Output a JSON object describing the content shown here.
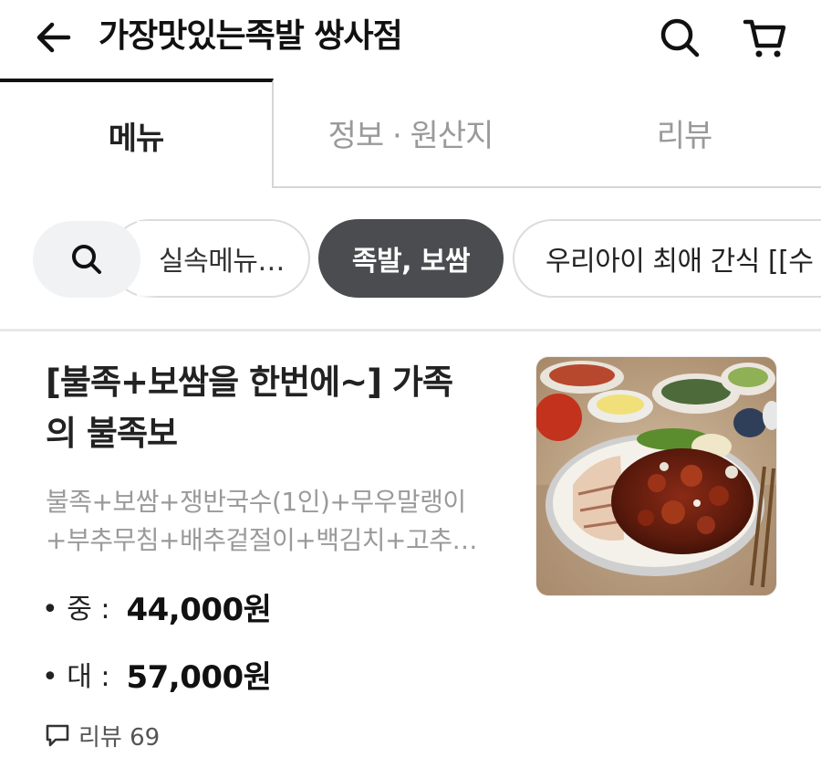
{
  "header": {
    "store_title": "가장맛있는족발 쌍사점",
    "icons": {
      "back": "back-arrow-icon",
      "search": "search-icon",
      "cart": "cart-icon"
    }
  },
  "tabs": [
    {
      "label": "메뉴",
      "active": true
    },
    {
      "label": "정보 · 원산지",
      "active": false
    },
    {
      "label": "리뷰",
      "active": false
    }
  ],
  "categories": [
    {
      "label": "실속메뉴…",
      "selected": false
    },
    {
      "label": "족발, 보쌈",
      "selected": true
    },
    {
      "label": "우리아이 최애 간식 [[수",
      "selected": false
    }
  ],
  "menu_item": {
    "name": "[불족+보쌈을 한번에~] 가족의 불족보",
    "name_lines": [
      "[불족+보쌈을 한번에~] 가족",
      "의 불족보"
    ],
    "description_lines": [
      "불족+보쌈+쟁반국수(1인)+무우말랭이",
      "+부추무침+배추겉절이+백김치+고추…"
    ],
    "prices": [
      {
        "size": "• 중 :",
        "amount": "44,000원"
      },
      {
        "size": "• 대 :",
        "amount": "57,000원"
      }
    ],
    "review_label": "리뷰 69",
    "image": "spicy-pork-feet-and-bossam-platter"
  },
  "colors": {
    "active_chip_bg": "#4a4c4f",
    "inactive_tab_text": "#9a9a9a",
    "description_text": "#9a9a9a"
  }
}
